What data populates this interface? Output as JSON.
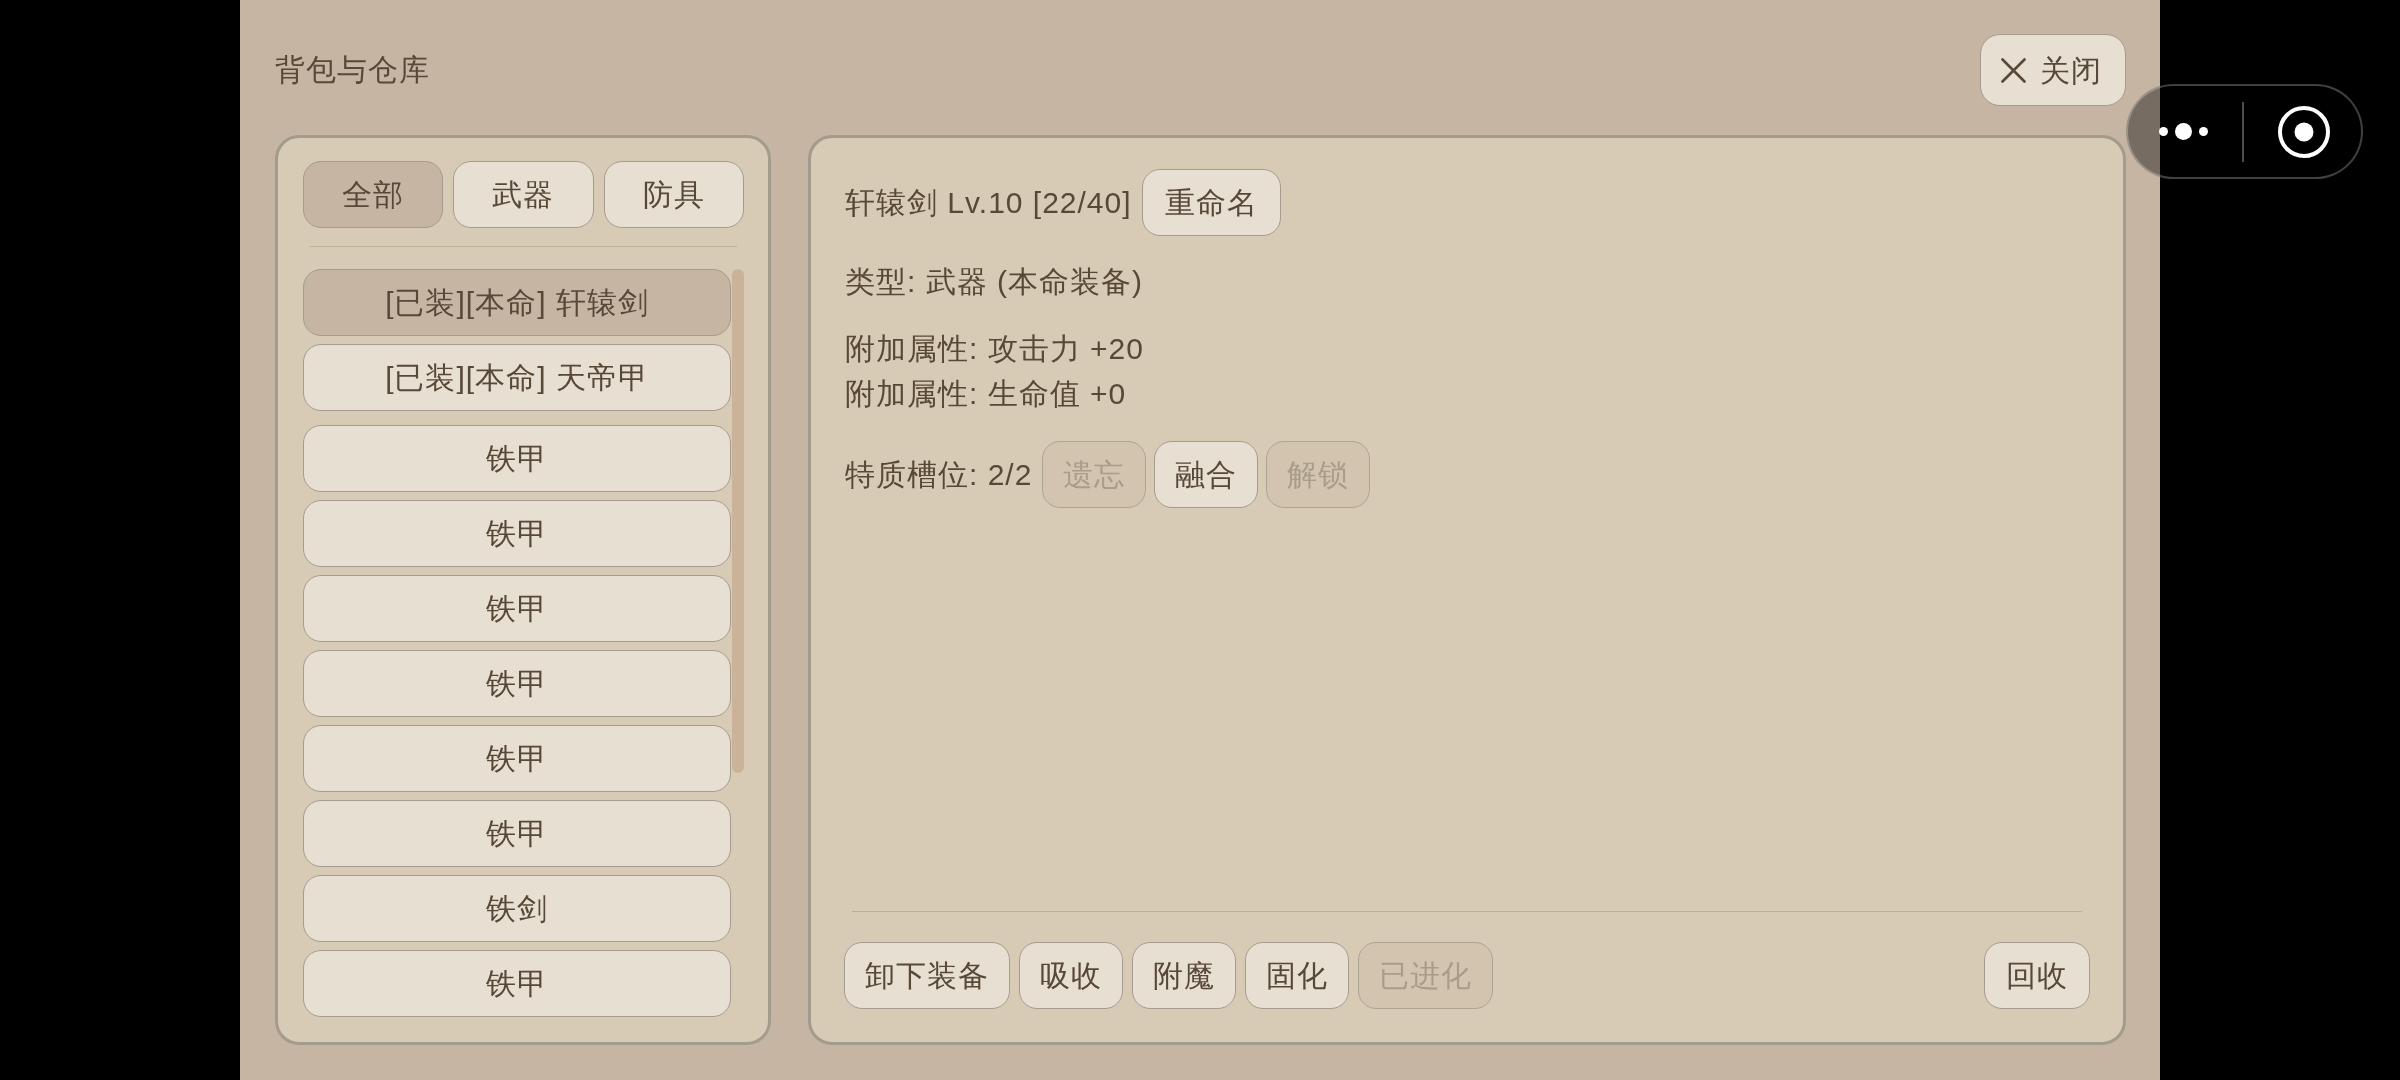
{
  "window": {
    "title": "背包与仓库",
    "close_button": {
      "label": "关闭"
    }
  },
  "filter_tabs": [
    {
      "label": "全部",
      "selected": true
    },
    {
      "label": "武器",
      "selected": false
    },
    {
      "label": "防具",
      "selected": false
    }
  ],
  "item_list": {
    "equipped_items": [
      {
        "label": "[已装][本命] 轩辕剑",
        "selected": true
      },
      {
        "label": "[已装][本命] 天帝甲",
        "selected": false
      }
    ],
    "bag_items": [
      {
        "label": "铁甲",
        "selected": false
      },
      {
        "label": "铁甲",
        "selected": false
      },
      {
        "label": "铁甲",
        "selected": false
      },
      {
        "label": "铁甲",
        "selected": false
      },
      {
        "label": "铁甲",
        "selected": false
      },
      {
        "label": "铁甲",
        "selected": false
      },
      {
        "label": "铁剑",
        "selected": false
      },
      {
        "label": "铁甲",
        "selected": false
      }
    ]
  },
  "detail": {
    "heading": "轩辕剑 Lv.10 [22/40]",
    "rename_button": {
      "label": "重命名"
    },
    "type_line": "类型: 武器 (本命装备)",
    "attributes": [
      "附加属性: 攻击力 +20",
      "附加属性: 生命值 +0"
    ],
    "trait_slots": "特质槽位: 2/2",
    "trait_buttons": [
      {
        "label": "遗忘",
        "disabled": true
      },
      {
        "label": "融合",
        "disabled": false
      },
      {
        "label": "解锁",
        "disabled": true
      }
    ],
    "actions": [
      {
        "label": "卸下装备",
        "disabled": false
      },
      {
        "label": "吸收",
        "disabled": false
      },
      {
        "label": "附魔",
        "disabled": false
      },
      {
        "label": "固化",
        "disabled": false
      },
      {
        "label": "已进化",
        "disabled": true
      }
    ],
    "recycle_button": {
      "label": "回收"
    }
  }
}
